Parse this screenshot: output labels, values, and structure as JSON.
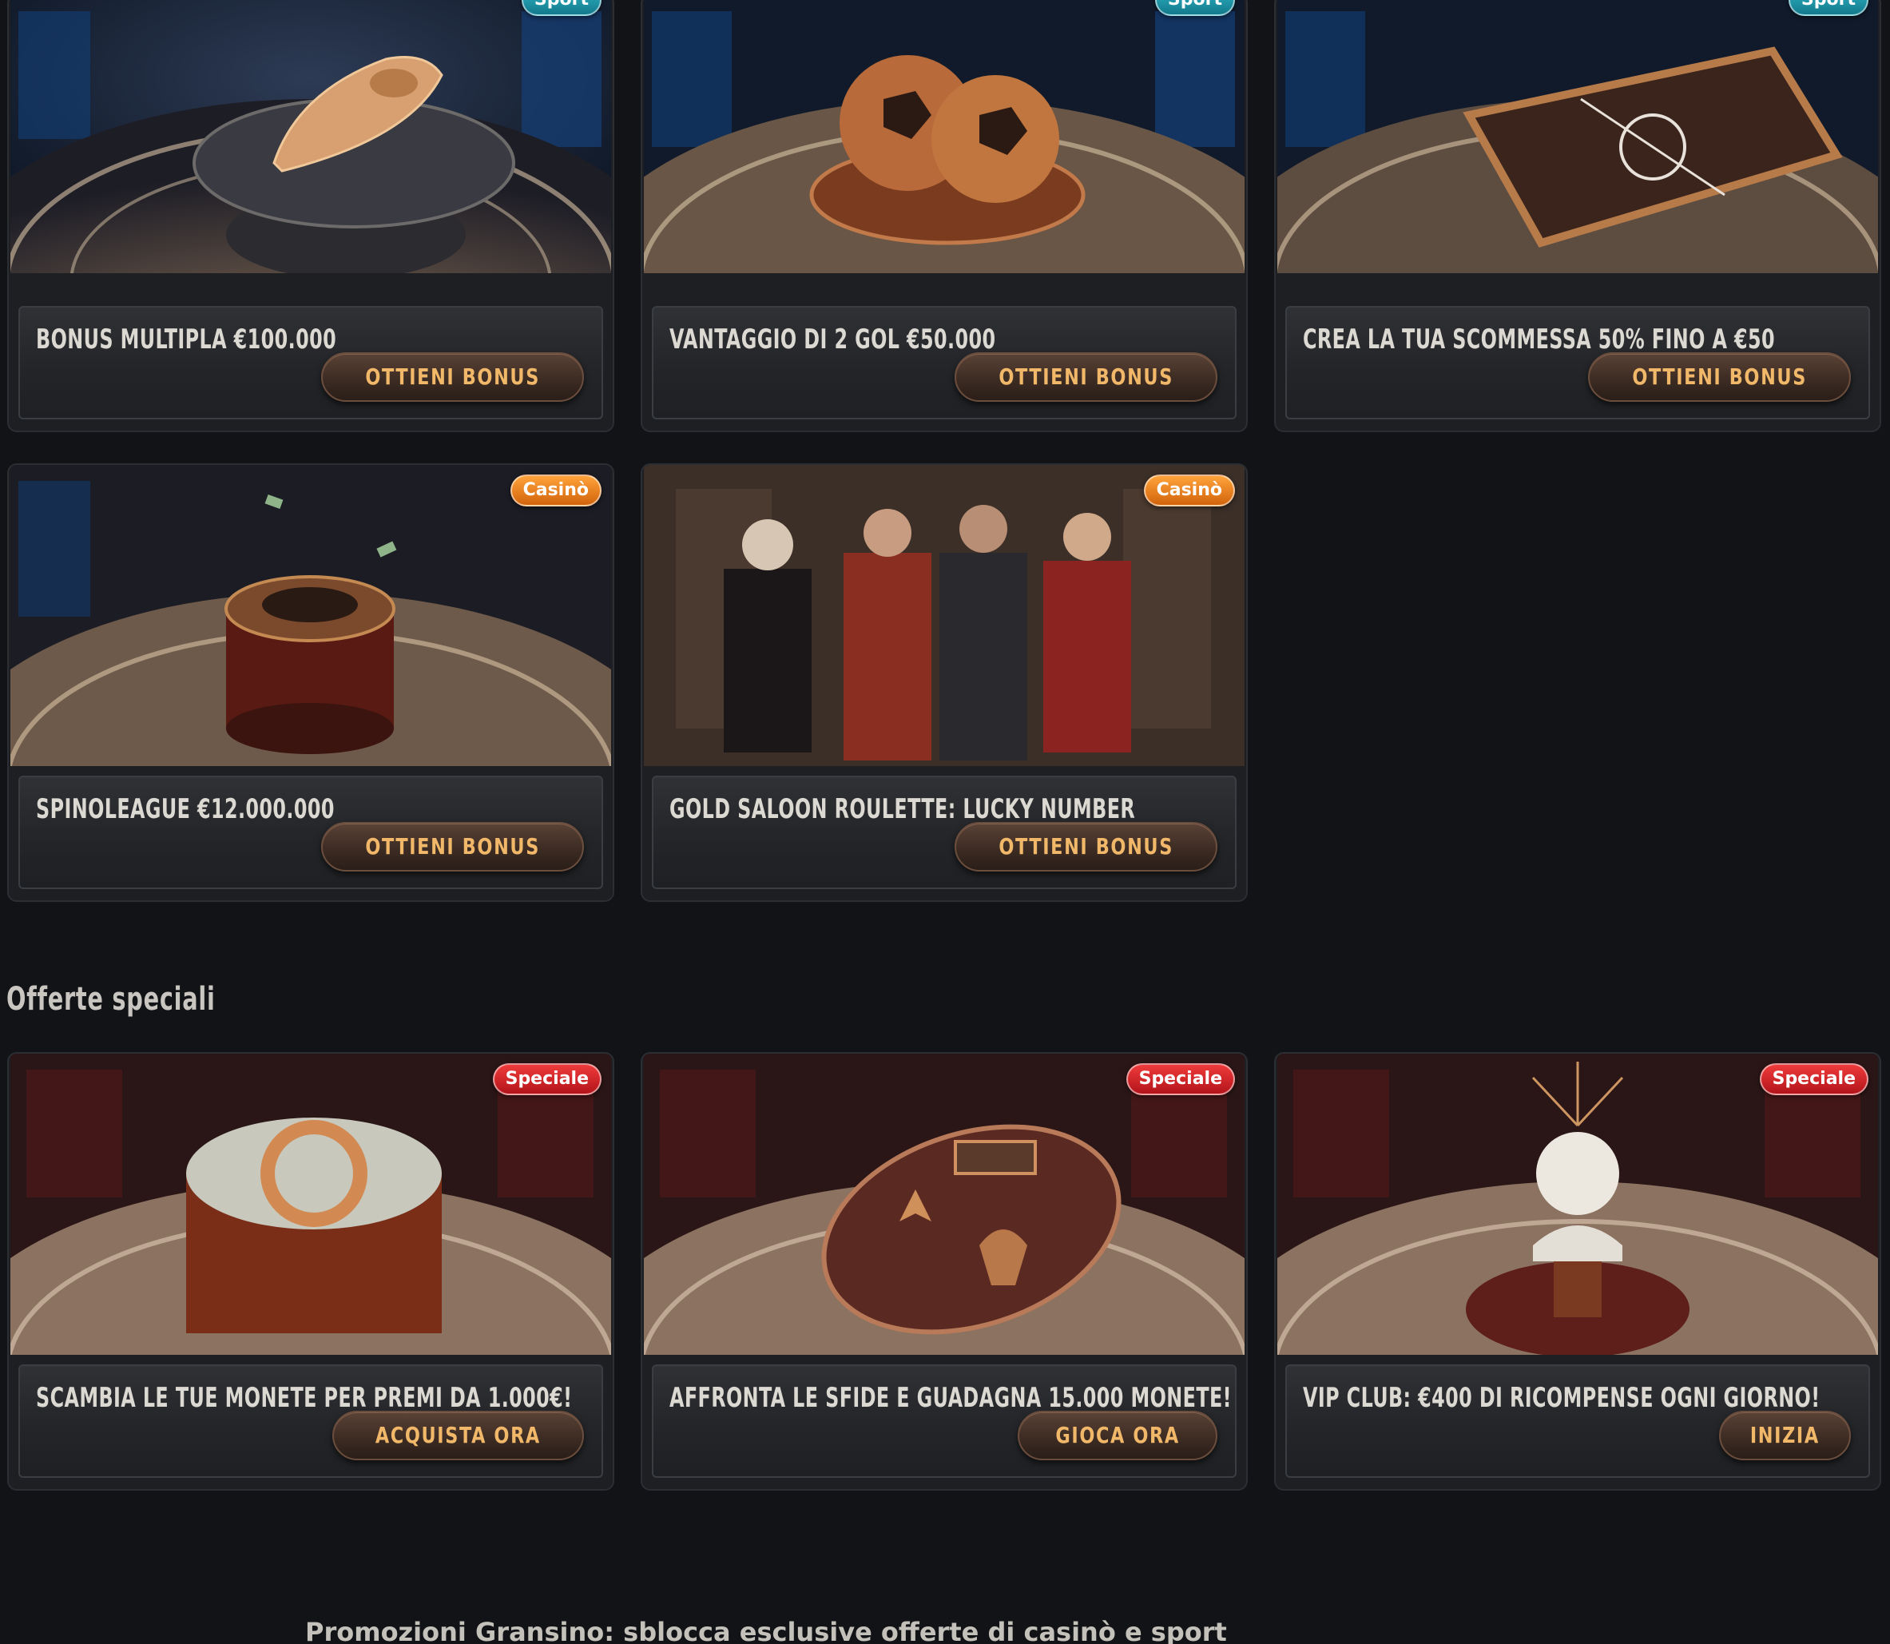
{
  "colors": {
    "background": "#111316",
    "button_text": "#f2b86a",
    "badge_sport": "#1f9cb0",
    "badge_casino": "#f08a1e",
    "badge_special": "#d52228"
  },
  "cards": [
    {
      "badge": "Sport",
      "title": "Bonus Multipla €100.000",
      "button": "Ottieni Bonus",
      "image": "golden football boot on pedestal"
    },
    {
      "badge": "Sport",
      "title": "Vantaggio di 2 gol €50.000",
      "button": "Ottieni Bonus",
      "image": "bronze footballs in bowl"
    },
    {
      "badge": "Sport",
      "title": "Crea la tua scommessa 50% fino a €50",
      "button": "Ottieni Bonus",
      "image": "tactics board"
    },
    {
      "badge": "Casinò",
      "title": "SpinoLeague €12.000.000",
      "button": "Ottieni Bonus",
      "image": "roulette wheel with money"
    },
    {
      "badge": "Casinò",
      "title": "Gold Saloon Roulette: Lucky Number",
      "button": "Ottieni Bonus",
      "image": "four characters in saloon"
    }
  ],
  "special_section": {
    "title": "Offerte speciali",
    "cards": [
      {
        "badge": "Speciale",
        "title": "Scambia le tue monete per premi da 1.000€!",
        "button": "Acquista ora",
        "image": "money pile with logo"
      },
      {
        "badge": "Speciale",
        "title": "Affronta le sfide e guadagna 15.000 monete!",
        "button": "Gioca ora",
        "image": "badges on pedestal"
      },
      {
        "badge": "Speciale",
        "title": "VIP Club: €400 di ricompense ogni giorno!",
        "button": "Inizia",
        "image": "marble bust on pedestal"
      }
    ]
  },
  "footer": {
    "heading": "Promozioni Gransino: sblocca esclusive offerte di casinò e sport"
  }
}
